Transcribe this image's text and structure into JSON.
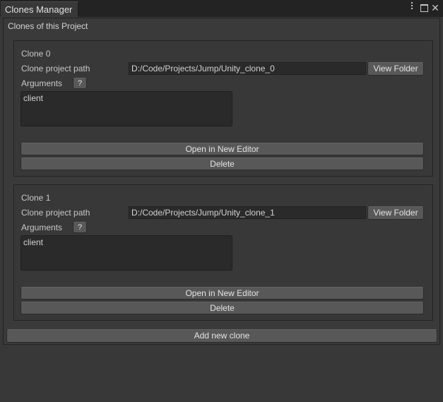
{
  "window": {
    "tab_title": "Clones Manager",
    "controls": [
      "menu-icon",
      "maximize-icon",
      "close-icon"
    ],
    "close_glyph": "✕"
  },
  "section": {
    "title": "Clones of this Project"
  },
  "clones": [
    {
      "title": "Clone 0",
      "path_label": "Clone project path",
      "path_value": "D:/Code/Projects/Jump/Unity_clone_0",
      "view_folder_label": "View Folder",
      "arguments_label": "Arguments",
      "help_label": "?",
      "arguments_value": "client",
      "open_label": "Open in New Editor",
      "delete_label": "Delete"
    },
    {
      "title": "Clone 1",
      "path_label": "Clone project path",
      "path_value": "D:/Code/Projects/Jump/Unity_clone_1",
      "view_folder_label": "View Folder",
      "arguments_label": "Arguments",
      "help_label": "?",
      "arguments_value": "client",
      "open_label": "Open in New Editor",
      "delete_label": "Delete"
    }
  ],
  "add_clone_label": "Add new clone",
  "colors": {
    "background": "#383838",
    "tabbar": "#232323",
    "field": "#2a2a2a",
    "button": "#585858"
  }
}
